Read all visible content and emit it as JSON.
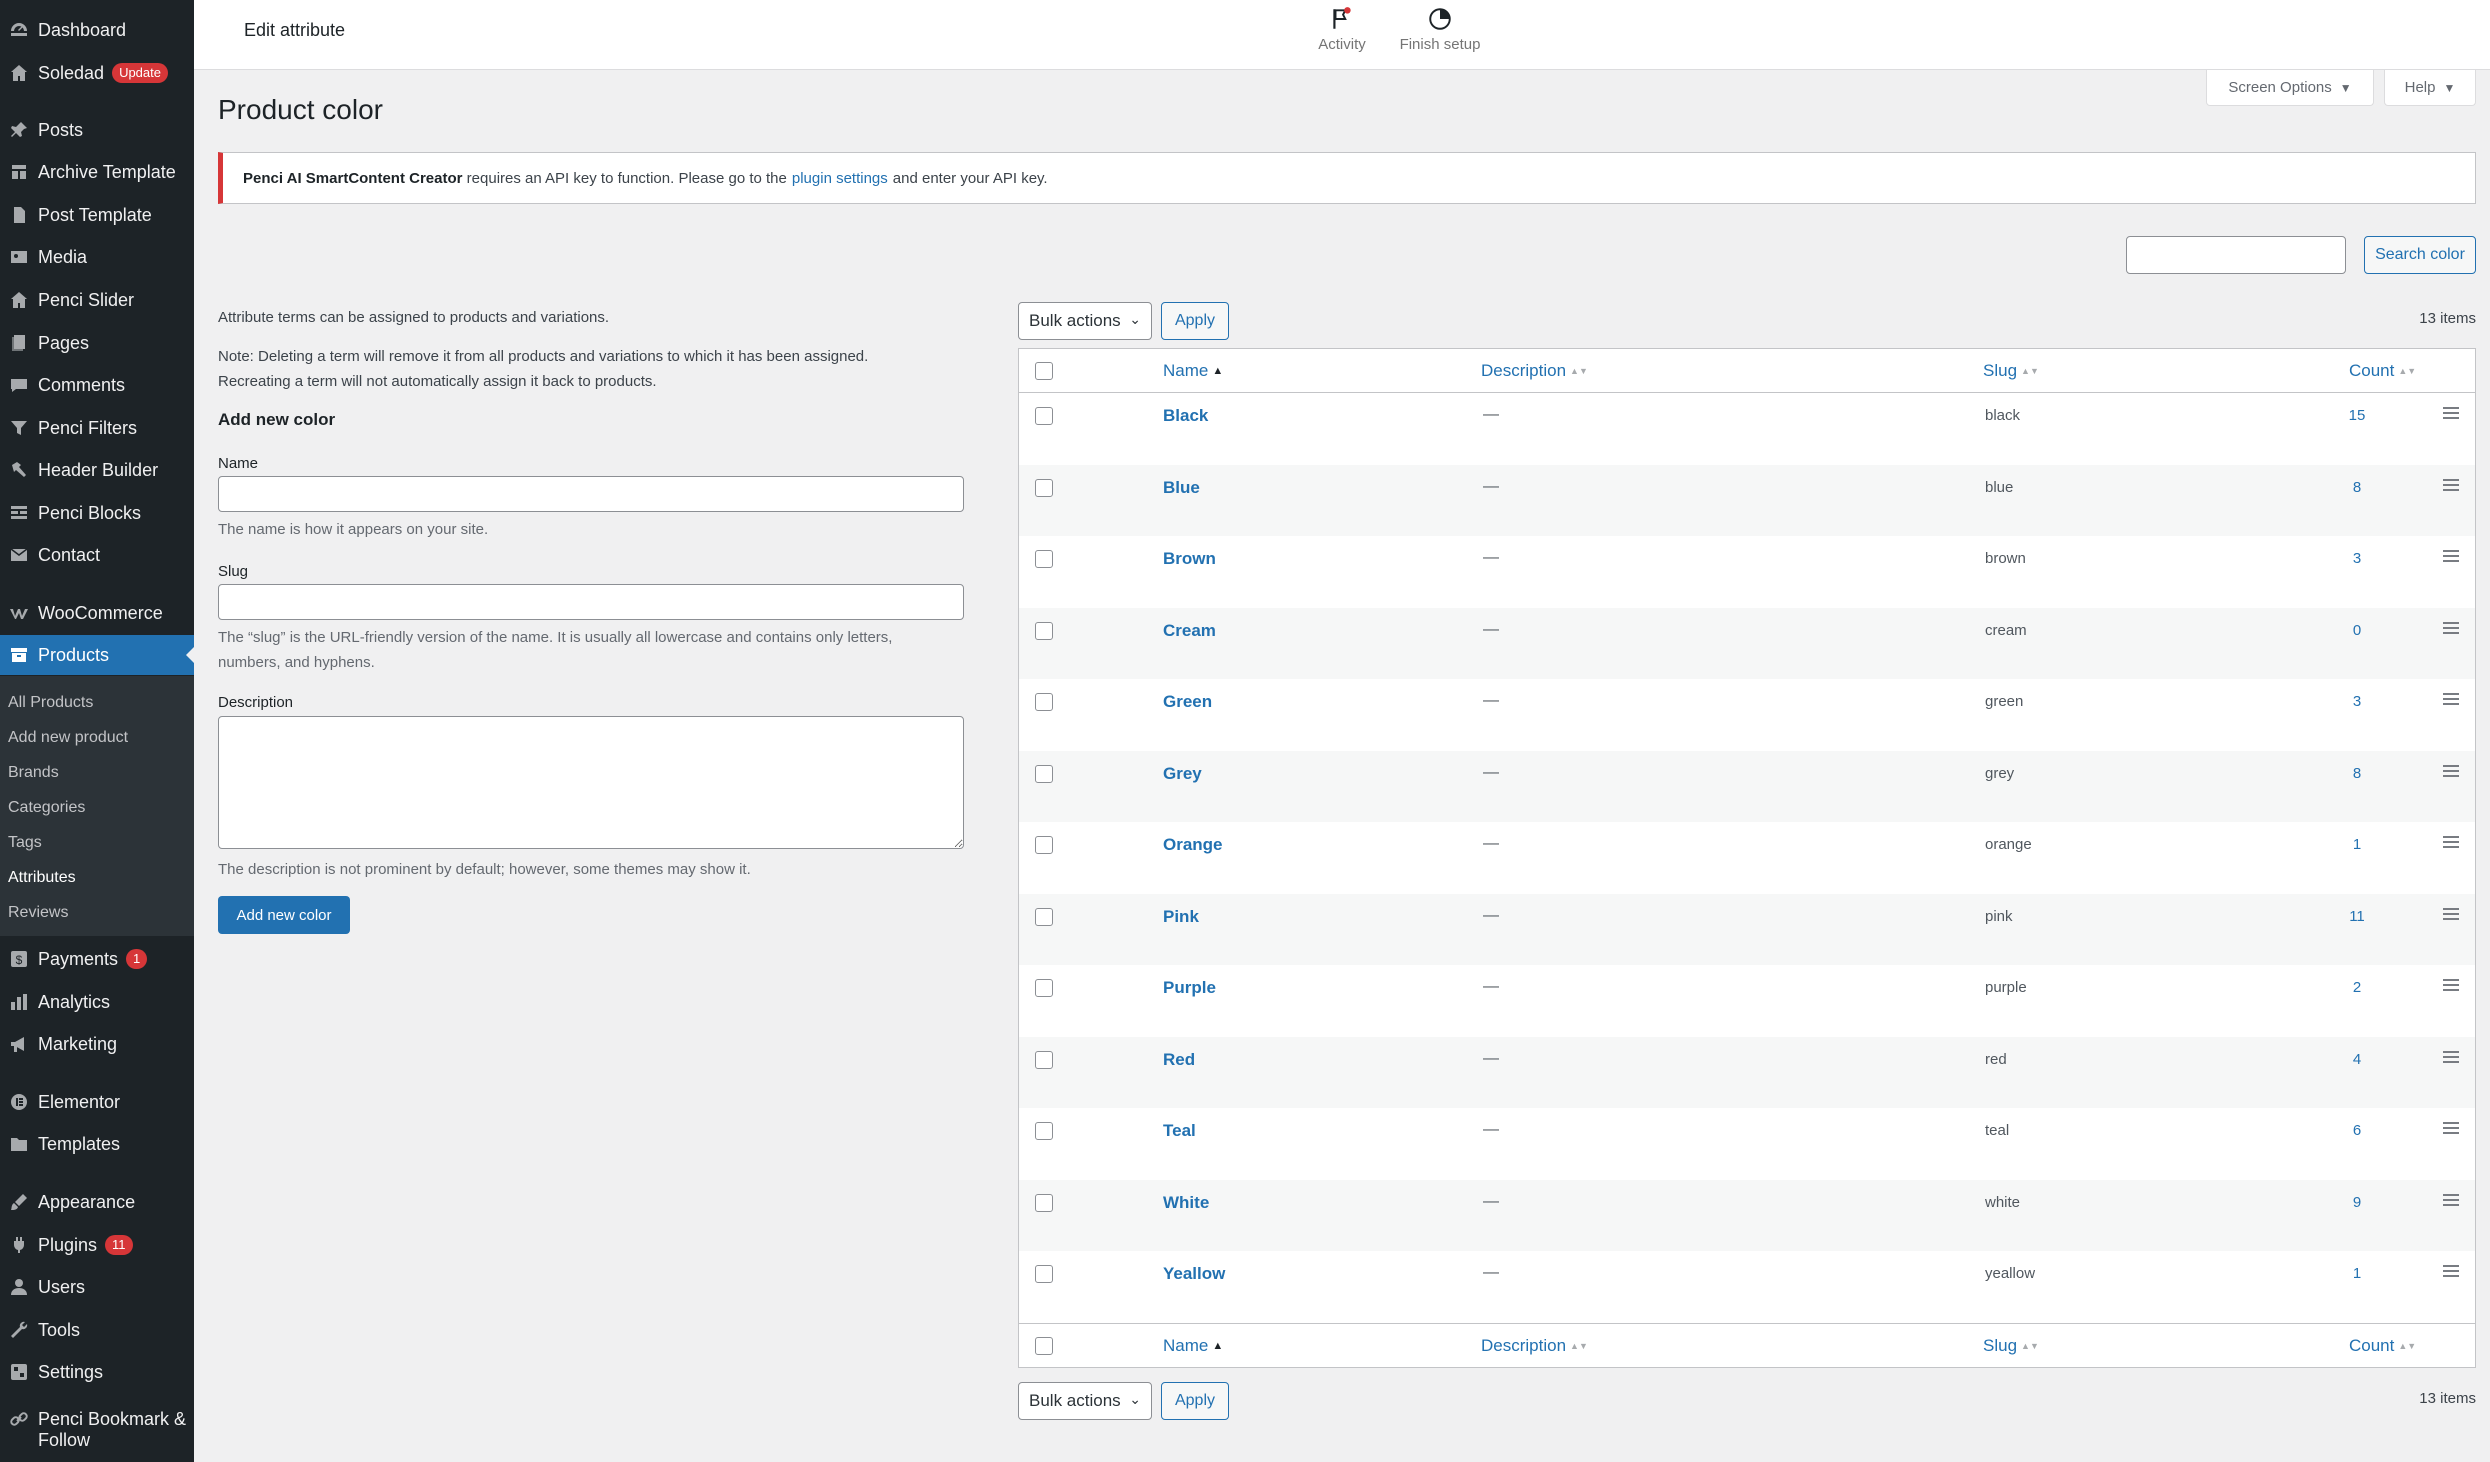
{
  "sidebar": {
    "items": [
      {
        "label": "Dashboard",
        "icon": "dashboard-icon"
      },
      {
        "label": "Soledad",
        "icon": "home-icon",
        "badge": "Update"
      },
      {
        "label": "Posts",
        "icon": "pin-icon"
      },
      {
        "label": "Archive Template",
        "icon": "template-icon"
      },
      {
        "label": "Post Template",
        "icon": "page-icon"
      },
      {
        "label": "Media",
        "icon": "media-icon"
      },
      {
        "label": "Penci Slider",
        "icon": "home-icon"
      },
      {
        "label": "Pages",
        "icon": "pages-icon"
      },
      {
        "label": "Comments",
        "icon": "comment-icon"
      },
      {
        "label": "Penci Filters",
        "icon": "filter-icon"
      },
      {
        "label": "Header Builder",
        "icon": "hammer-icon"
      },
      {
        "label": "Penci Blocks",
        "icon": "blocks-icon"
      },
      {
        "label": "Contact",
        "icon": "mail-icon"
      },
      {
        "label": "WooCommerce",
        "icon": "woo-icon"
      },
      {
        "label": "Products",
        "icon": "archive-icon"
      },
      {
        "label": "Payments",
        "icon": "dollar-icon",
        "badge": "1"
      },
      {
        "label": "Analytics",
        "icon": "chart-icon"
      },
      {
        "label": "Marketing",
        "icon": "megaphone-icon"
      },
      {
        "label": "Elementor",
        "icon": "elementor-icon"
      },
      {
        "label": "Templates",
        "icon": "folder-icon"
      },
      {
        "label": "Appearance",
        "icon": "brush-icon"
      },
      {
        "label": "Plugins",
        "icon": "plugin-icon",
        "badge": "11"
      },
      {
        "label": "Users",
        "icon": "users-icon"
      },
      {
        "label": "Tools",
        "icon": "wrench-icon"
      },
      {
        "label": "Settings",
        "icon": "settings-icon"
      },
      {
        "label": "Penci Bookmark & Follow",
        "icon": "link-icon"
      }
    ],
    "submenu": [
      "All Products",
      "Add new product",
      "Brands",
      "Categories",
      "Tags",
      "Attributes",
      "Reviews"
    ]
  },
  "topbar": {
    "heading": "Edit attribute",
    "activity": "Activity",
    "finish_setup": "Finish setup"
  },
  "screen_options": "Screen Options",
  "help": "Help",
  "page_title": "Product color",
  "notice": {
    "plugin": "Penci AI SmartContent Creator",
    "text1": " requires an API key to function. Please go to the",
    "link": "plugin settings",
    "text2": "and enter your API key."
  },
  "search": {
    "button": "Search color",
    "value": ""
  },
  "form": {
    "intro": "Attribute terms can be assigned to products and variations.",
    "note_line1": "Note: Deleting a term will remove it from all products and variations to which it has been assigned.",
    "note_line2": "Recreating a term will not automatically assign it back to products.",
    "add_title": "Add new color",
    "name_label": "Name",
    "name_help": "The name is how it appears on your site.",
    "slug_label": "Slug",
    "slug_help_line1": "The “slug” is the URL-friendly version of the name. It is usually all lowercase and contains only letters,",
    "slug_help_line2": "numbers, and hyphens.",
    "description_label": "Description",
    "description_help": "The description is not prominent by default; however, some themes may show it.",
    "submit": "Add new color"
  },
  "bulk": {
    "label": "Bulk actions",
    "apply": "Apply",
    "items_count": "13 items"
  },
  "table": {
    "columns": {
      "name": "Name",
      "description": "Description",
      "slug": "Slug",
      "count": "Count"
    },
    "rows": [
      {
        "name": "Black",
        "description": "—",
        "slug": "black",
        "count": "15"
      },
      {
        "name": "Blue",
        "description": "—",
        "slug": "blue",
        "count": "8"
      },
      {
        "name": "Brown",
        "description": "—",
        "slug": "brown",
        "count": "3"
      },
      {
        "name": "Cream",
        "description": "—",
        "slug": "cream",
        "count": "0"
      },
      {
        "name": "Green",
        "description": "—",
        "slug": "green",
        "count": "3"
      },
      {
        "name": "Grey",
        "description": "—",
        "slug": "grey",
        "count": "8"
      },
      {
        "name": "Orange",
        "description": "—",
        "slug": "orange",
        "count": "1"
      },
      {
        "name": "Pink",
        "description": "—",
        "slug": "pink",
        "count": "11"
      },
      {
        "name": "Purple",
        "description": "—",
        "slug": "purple",
        "count": "2"
      },
      {
        "name": "Red",
        "description": "—",
        "slug": "red",
        "count": "4"
      },
      {
        "name": "Teal",
        "description": "—",
        "slug": "teal",
        "count": "6"
      },
      {
        "name": "White",
        "description": "—",
        "slug": "white",
        "count": "9"
      },
      {
        "name": "Yeallow",
        "description": "—",
        "slug": "yeallow",
        "count": "1"
      }
    ]
  },
  "colors": {
    "accent": "#2271b1",
    "sidebar_bg": "#1d2327",
    "badge": "#d63638"
  }
}
